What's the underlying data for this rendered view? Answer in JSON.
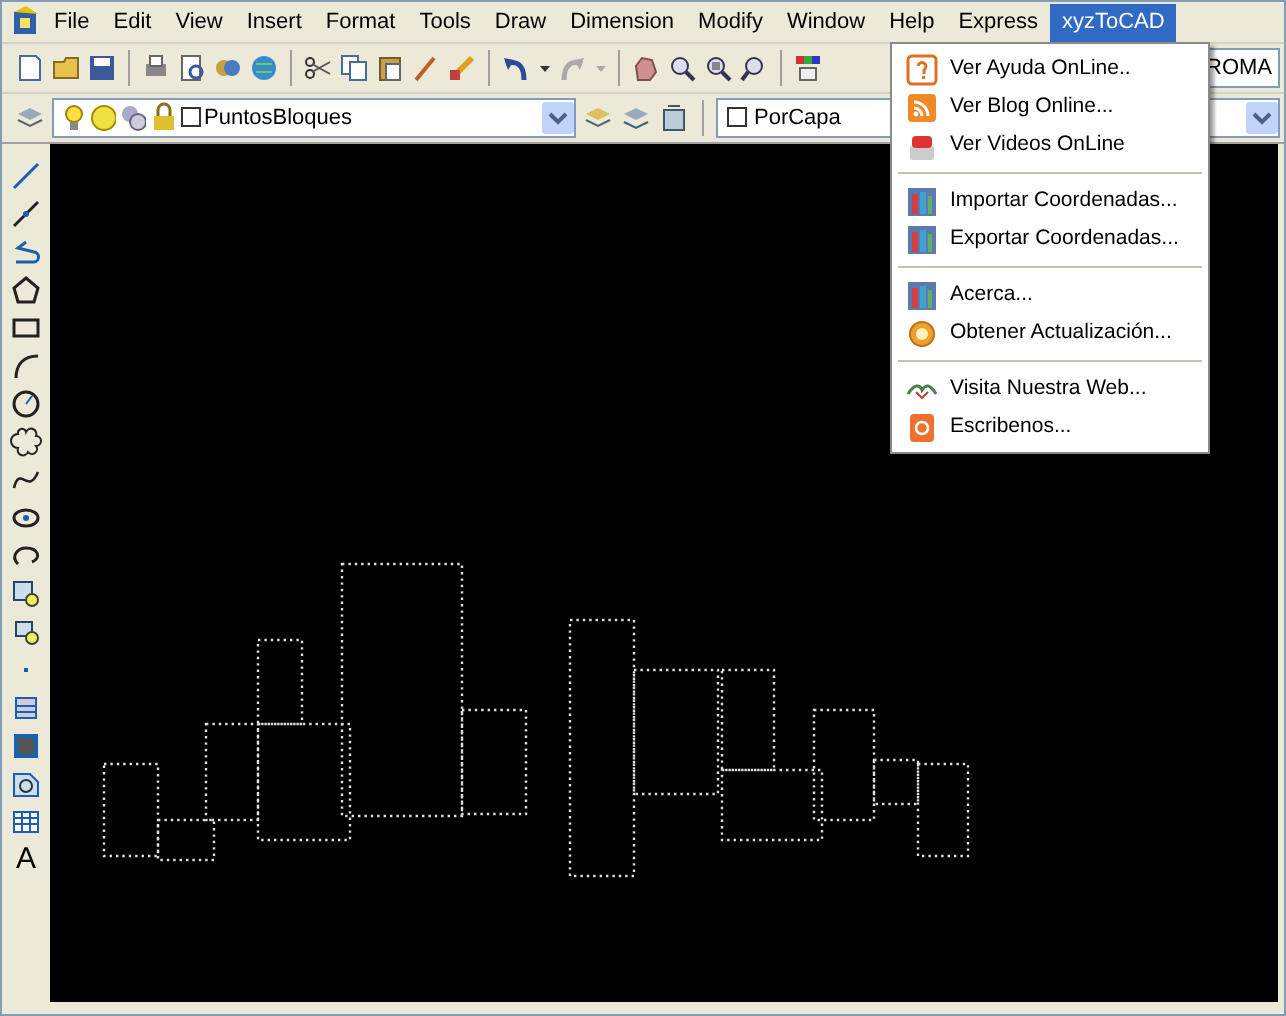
{
  "menu_bar": [
    {
      "label": "File",
      "selected": false
    },
    {
      "label": "Edit",
      "selected": false
    },
    {
      "label": "View",
      "selected": false
    },
    {
      "label": "Insert",
      "selected": false
    },
    {
      "label": "Format",
      "selected": false
    },
    {
      "label": "Tools",
      "selected": false
    },
    {
      "label": "Draw",
      "selected": false
    },
    {
      "label": "Dimension",
      "selected": false
    },
    {
      "label": "Modify",
      "selected": false
    },
    {
      "label": "Window",
      "selected": false
    },
    {
      "label": "Help",
      "selected": false
    },
    {
      "label": "Express",
      "selected": false
    },
    {
      "label": "xyzToCAD",
      "selected": true
    }
  ],
  "style_field": {
    "value": "ROMA"
  },
  "layer_dropdown": {
    "value": "PuntosBloques"
  },
  "color_dropdown": {
    "value": "PorCapa"
  },
  "draw_toolbar": {
    "text_tool": "A"
  },
  "dropdown_menu": {
    "groups": [
      {
        "items": [
          {
            "label": "Ver Ayuda OnLine..",
            "kind": "help"
          },
          {
            "label": "Ver Blog Online...",
            "kind": "rss"
          },
          {
            "label": "Ver Videos OnLine",
            "kind": "video"
          }
        ]
      },
      {
        "items": [
          {
            "label": "Importar Coordenadas...",
            "kind": "books"
          },
          {
            "label": "Exportar Coordenadas...",
            "kind": "books"
          }
        ]
      },
      {
        "items": [
          {
            "label": "Acerca...",
            "kind": "books"
          },
          {
            "label": "Obtener Actualización...",
            "kind": "update"
          }
        ]
      },
      {
        "items": [
          {
            "label": "Visita Nuestra Web...",
            "kind": "web"
          },
          {
            "label": "Escribenos...",
            "kind": "mail"
          }
        ]
      }
    ]
  }
}
